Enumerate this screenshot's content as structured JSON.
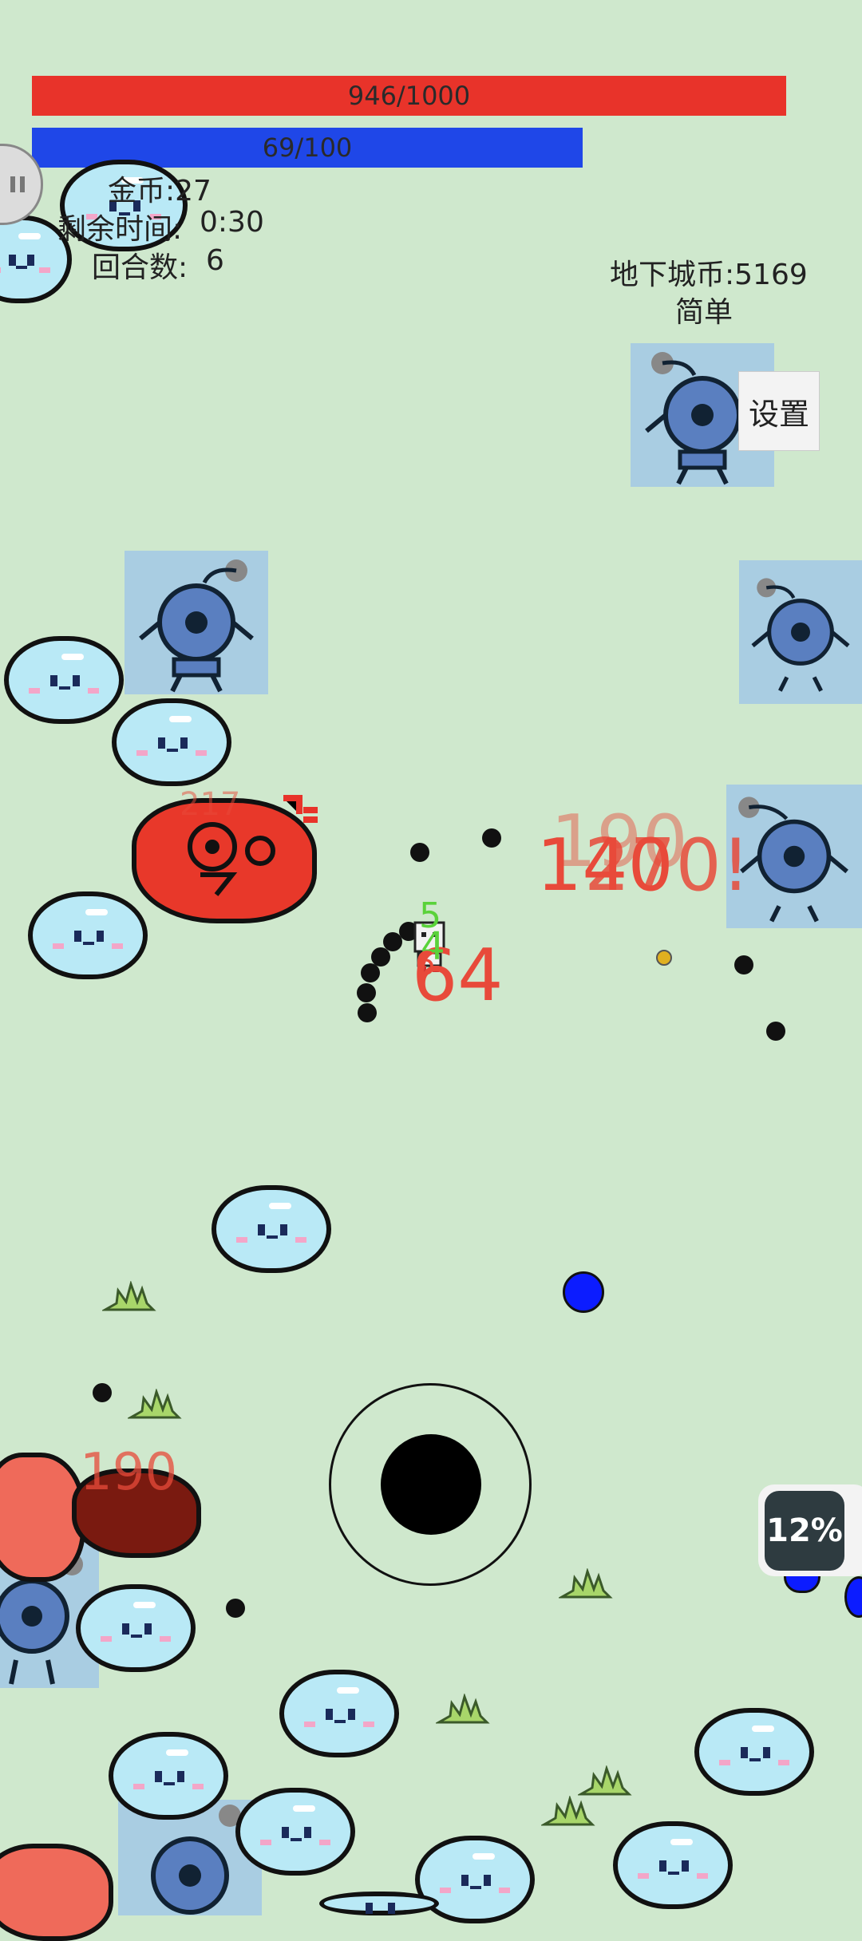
{
  "hud": {
    "hp_text": "946/1000",
    "hp_value": 946,
    "hp_max": 1000,
    "mp_text": "69/100",
    "mp_value": 69,
    "mp_max": 100,
    "gold_label": "金币:27",
    "time_label": "剩余时间:",
    "time_value": "0:30",
    "round_label": "回合数:",
    "round_value": "6",
    "dungeon_coins": "地下城币:5169",
    "difficulty": "简单",
    "settings_label": "设置"
  },
  "damage_numbers": {
    "center_top_faded": "190",
    "center_stacked_a": "140",
    "center_stacked_b": "270!",
    "player_hit": "64",
    "player_green_a": "5",
    "player_green_b": "4",
    "player_red_small": "6",
    "left_blob_num": "190",
    "red_blob_top_num": "217"
  },
  "progress_badge": {
    "label": "12%",
    "value_percent": 12
  },
  "colors": {
    "background": "#cfe8cd",
    "hp_bar": "#e8332a",
    "mp_bar": "#1f47e8",
    "slime": "#b9e9f6",
    "damage_text": "#e84a3a",
    "heal_text": "#5ad23a"
  },
  "icons": {
    "pause": "pause-icon",
    "joystick": "joystick-icon",
    "player": "player-sprite-icon",
    "slime": "blue-slime-icon",
    "robot": "robot-enemy-icon",
    "red_blob": "red-blob-enemy-icon",
    "grass": "grass-tuft-icon"
  }
}
